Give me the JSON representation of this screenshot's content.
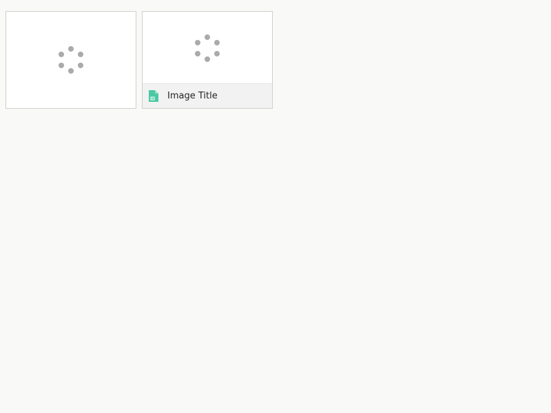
{
  "cards": [
    {
      "state": "loading",
      "spinner_icon": "loading-spinner-icon"
    },
    {
      "state": "loading",
      "spinner_icon": "loading-spinner-icon",
      "footer": {
        "file_icon": "image-file-icon",
        "title": "Image Title"
      }
    }
  ],
  "colors": {
    "background": "#f9f9f7",
    "card": "#ffffff",
    "card_border": "#cfcfcf",
    "footer": "#f2f2f2",
    "spinner_dot": "#aaaaaa",
    "file_icon": "#4cc9a4",
    "title_text": "#222222"
  }
}
